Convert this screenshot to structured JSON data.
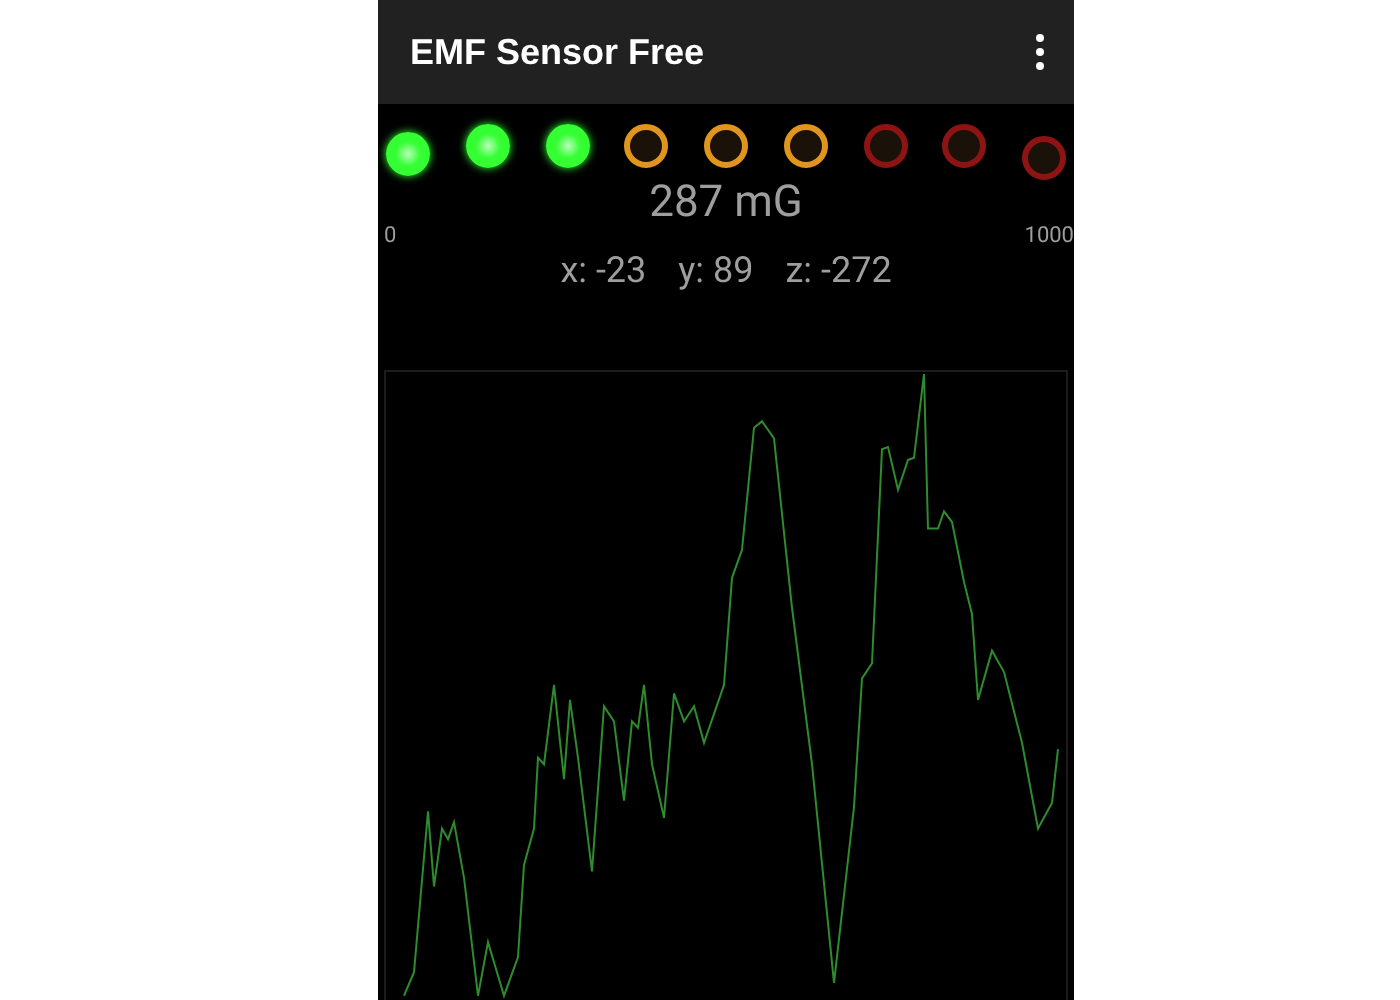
{
  "app_bar": {
    "title": "EMF Sensor Free"
  },
  "leds": [
    {
      "lit": true,
      "color": "#33ff33"
    },
    {
      "lit": true,
      "color": "#33ff33"
    },
    {
      "lit": true,
      "color": "#33ff33"
    },
    {
      "lit": false,
      "color": "#e0961c"
    },
    {
      "lit": false,
      "color": "#e0961c"
    },
    {
      "lit": false,
      "color": "#e0961c"
    },
    {
      "lit": false,
      "color": "#8e1414"
    },
    {
      "lit": false,
      "color": "#8e1414"
    },
    {
      "lit": false,
      "color": "#8e1414"
    }
  ],
  "reading": "287 mG",
  "scale": {
    "min": "0",
    "max": "1000"
  },
  "axes": [
    {
      "label": "x: -23"
    },
    {
      "label": "y: 89"
    },
    {
      "label": "z: -272"
    }
  ]
}
